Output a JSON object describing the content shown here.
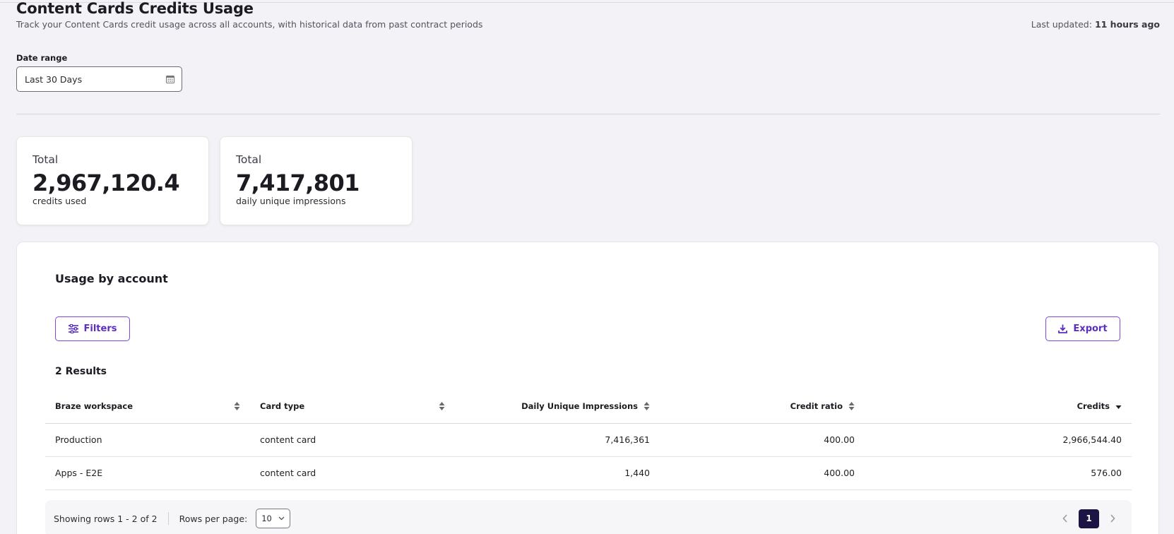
{
  "header": {
    "title": "Content Cards Credits Usage",
    "subtitle": "Track your Content Cards credit usage across all accounts, with historical data from past contract periods",
    "last_updated_label": "Last updated:",
    "last_updated_value": "11 hours ago"
  },
  "date_range": {
    "label": "Date range",
    "value": "Last 30 Days",
    "icon": "calendar-icon"
  },
  "stats": [
    {
      "label": "Total",
      "value": "2,967,120.4",
      "desc": "credits used"
    },
    {
      "label": "Total",
      "value": "7,417,801",
      "desc": "daily unique impressions"
    }
  ],
  "usage": {
    "title": "Usage by account",
    "filters_label": "Filters",
    "export_label": "Export",
    "results": "2 Results",
    "columns": [
      "Braze workspace",
      "Card type",
      "Daily Unique Impressions",
      "Credit ratio",
      "Credits"
    ],
    "rows": [
      {
        "workspace": "Production",
        "card_type": "content card",
        "impressions": "7,416,361",
        "ratio": "400.00",
        "credits": "2,966,544.40"
      },
      {
        "workspace": "Apps - E2E",
        "card_type": "content card",
        "impressions": "1,440",
        "ratio": "400.00",
        "credits": "576.00"
      }
    ],
    "pagination": {
      "showing": "Showing rows 1 - 2 of 2",
      "rows_per_page_label": "Rows per page:",
      "rows_per_page_value": "10",
      "current_page": "1"
    }
  },
  "colors": {
    "accent": "#7a4bd6",
    "page_bg": "#f3f2f7",
    "active_page": "#1c1544"
  }
}
